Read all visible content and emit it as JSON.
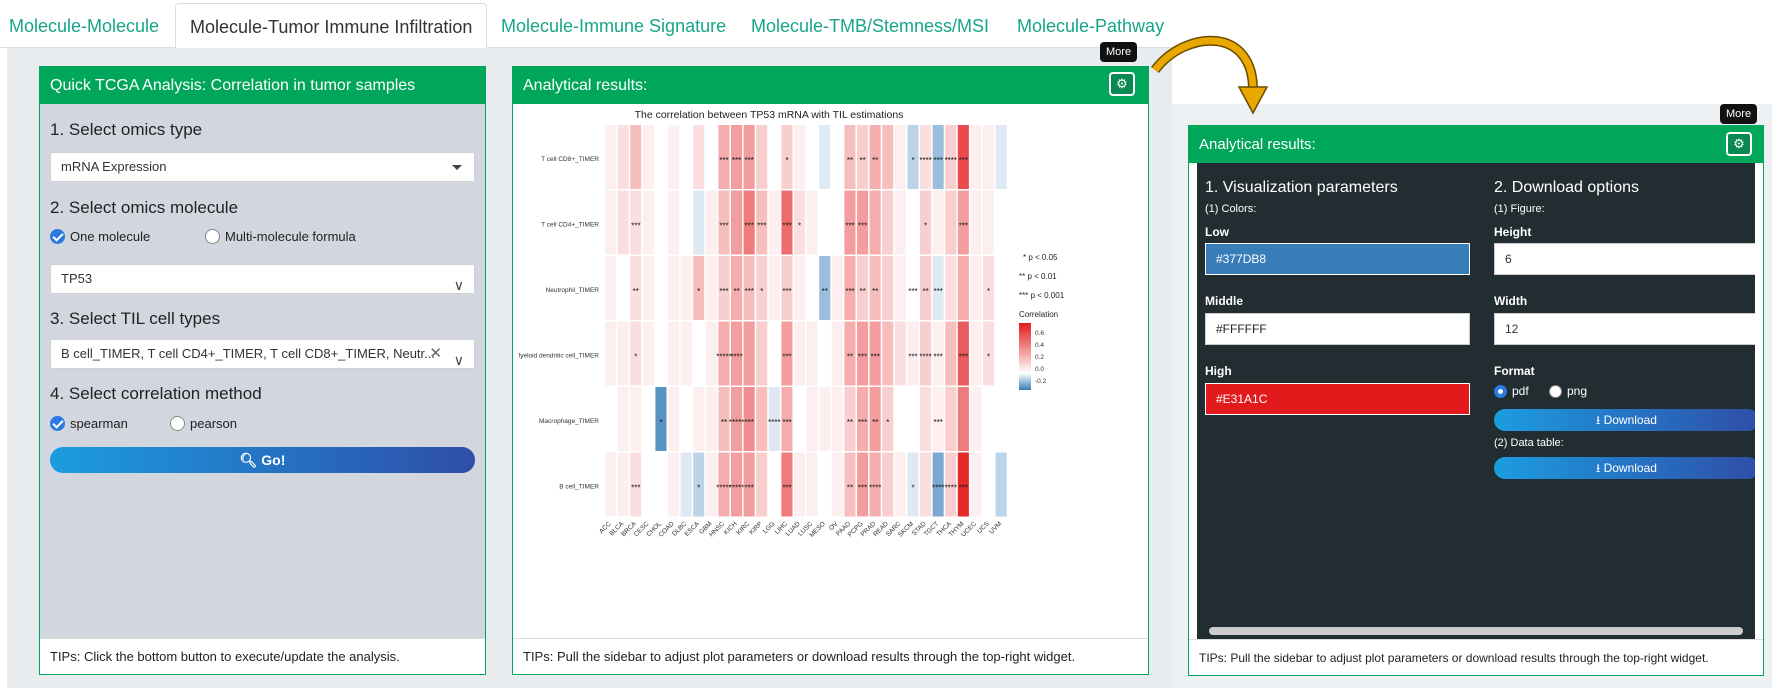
{
  "tabs": [
    "Molecule-Molecule",
    "Molecule-Tumor Immune Infiltration",
    "Molecule-Immune Signature",
    "Molecule-TMB/Stemness/MSI",
    "Molecule-Pathway"
  ],
  "sidebar": {
    "title": "Quick TCGA Analysis: Correlation in tumor samples",
    "step1_label": "1. Select omics type",
    "omics_type": "mRNA Expression",
    "step2_label": "2. Select omics molecule",
    "radio_one": "One molecule",
    "radio_multi": "Multi-molecule formula",
    "molecule": "TP53",
    "step3_label": "3. Select TIL cell types",
    "til_types": "B cell_TIMER, T cell CD4+_TIMER, T cell CD8+_TIMER, Neutr...",
    "step4_label": "4. Select correlation method",
    "method_spearman": "spearman",
    "method_pearson": "pearson",
    "go_label": "Go!",
    "tips": "TIPs: Click the bottom button to execute/update the analysis."
  },
  "results": {
    "title": "Analytical results:",
    "tooltip": "More",
    "tips": "TIPs: Pull the sidebar to adjust plot parameters or download results through the top-right widget."
  },
  "chart_data": {
    "type": "heatmap",
    "title": "The correlation between TP53 mRNA with TIL estimations",
    "rows": [
      "T cell CD8+_TIMER",
      "T cell CD4+_TIMER",
      "Neutrophil_TIMER",
      "Myeloid dendritic cell_TIMER",
      "Macrophage_TIMER",
      "B cell_TIMER"
    ],
    "columns": [
      "ACC",
      "BLCA",
      "BRCA",
      "CESC",
      "CHOL",
      "COAD",
      "DLBC",
      "ESCA",
      "GBM",
      "HNSC",
      "KICH",
      "KIRC",
      "KIRP",
      "LGG",
      "LIHC",
      "LUAD",
      "LUSC",
      "MESO",
      "OV",
      "PAAD",
      "PCPG",
      "PRAD",
      "READ",
      "SARC",
      "SKCM",
      "STAD",
      "TGCT",
      "THCA",
      "THYM",
      "UCEC",
      "UCS",
      "UVM"
    ],
    "values": [
      [
        0.05,
        0.1,
        0.2,
        0.05,
        0.0,
        0.05,
        0.0,
        0.1,
        0.0,
        0.25,
        0.3,
        0.3,
        0.15,
        0.0,
        0.15,
        0.05,
        0.0,
        -0.05,
        0.0,
        0.2,
        0.15,
        0.25,
        0.2,
        0.05,
        -0.1,
        0.1,
        -0.15,
        0.15,
        0.55,
        0.05,
        0.05,
        -0.05
      ],
      [
        0.05,
        0.1,
        0.1,
        0.05,
        0.0,
        0.05,
        0.0,
        -0.05,
        0.05,
        0.2,
        0.3,
        0.4,
        0.2,
        0.05,
        0.45,
        0.1,
        0.05,
        0.0,
        0.0,
        0.3,
        0.3,
        0.25,
        0.15,
        0.05,
        0.0,
        0.15,
        0.05,
        0.15,
        0.3,
        0.05,
        0.05,
        0.0
      ],
      [
        0.05,
        0.0,
        0.1,
        0.05,
        0.0,
        0.05,
        0.05,
        0.2,
        0.05,
        0.15,
        0.25,
        0.2,
        0.15,
        0.05,
        0.15,
        0.05,
        0.0,
        -0.15,
        0.05,
        0.25,
        0.15,
        0.2,
        0.15,
        0.05,
        0.0,
        0.15,
        -0.05,
        0.1,
        0.25,
        0.05,
        0.1,
        0.0
      ],
      [
        0.05,
        0.05,
        0.1,
        0.05,
        0.0,
        0.05,
        0.05,
        0.0,
        0.05,
        0.25,
        0.3,
        0.3,
        0.15,
        0.0,
        0.3,
        0.05,
        0.05,
        0.0,
        0.05,
        0.25,
        0.3,
        0.3,
        0.2,
        0.1,
        0.05,
        0.15,
        0.05,
        0.2,
        0.5,
        0.05,
        0.1,
        0.0
      ],
      [
        0.0,
        0.05,
        0.05,
        0.0,
        -0.25,
        0.05,
        0.0,
        0.05,
        0.05,
        0.2,
        0.3,
        0.35,
        0.2,
        -0.05,
        0.25,
        0.0,
        0.05,
        0.05,
        0.05,
        0.15,
        0.25,
        0.3,
        0.15,
        0.0,
        0.0,
        0.1,
        0.05,
        0.15,
        0.4,
        0.05,
        0.0,
        0.0
      ],
      [
        0.05,
        0.05,
        0.1,
        0.0,
        0.0,
        0.05,
        -0.05,
        -0.1,
        0.05,
        0.25,
        0.3,
        0.3,
        0.15,
        0.0,
        0.4,
        0.05,
        0.05,
        0.0,
        0.05,
        0.2,
        0.3,
        0.25,
        0.15,
        0.05,
        -0.05,
        0.1,
        -0.2,
        0.15,
        0.65,
        0.05,
        0.0,
        -0.1
      ]
    ],
    "stars": [
      [
        "",
        "",
        "",
        "",
        "",
        "",
        "",
        "",
        "",
        "***",
        "***",
        "***",
        "",
        "",
        "*",
        "",
        "",
        "",
        "",
        "**",
        "**",
        "**",
        "",
        "",
        "*",
        "****",
        "***",
        "****",
        "***",
        "",
        "",
        ""
      ],
      [
        "",
        "",
        "***",
        "",
        "",
        "",
        "",
        "",
        "",
        "***",
        "",
        "***",
        "***",
        "",
        "***",
        "*",
        "",
        "",
        "",
        "***",
        "***",
        "",
        "",
        "",
        "",
        "*",
        "",
        "",
        "***",
        "",
        "",
        ""
      ],
      [
        "",
        "",
        "**",
        "",
        "",
        "",
        "",
        "*",
        "",
        "***",
        "**",
        "***",
        "*",
        "",
        "***",
        "",
        "",
        "**",
        "",
        "***",
        "**",
        "**",
        "",
        "",
        "***",
        "**",
        "***",
        "",
        "",
        "",
        "*",
        ""
      ],
      [
        "",
        "",
        "*",
        "",
        "",
        "",
        "",
        "",
        "",
        "*****",
        "****",
        "",
        "",
        "",
        "***",
        "",
        "",
        "",
        "",
        "**",
        "***",
        "***",
        "",
        "",
        "***",
        "****",
        "***",
        "",
        "***",
        "",
        "*",
        ""
      ],
      [
        "",
        "",
        "",
        "",
        "*",
        "",
        "",
        "",
        "",
        "**",
        "*****",
        "***",
        "",
        "****",
        "***",
        "",
        "",
        "",
        "",
        "**",
        "***",
        "**",
        "*",
        "",
        "",
        "",
        "***",
        "",
        "",
        "",
        "",
        ""
      ],
      [
        "",
        "",
        "***",
        "",
        "",
        "",
        "",
        "*",
        "",
        "*****",
        "*****",
        "***",
        "",
        "",
        "***",
        "",
        "",
        "",
        "",
        "**",
        "***",
        "****",
        "",
        "",
        "*",
        "",
        "****",
        "****",
        "***",
        "",
        "",
        ""
      ]
    ],
    "legend_sig": [
      "* p < 0.05",
      "** p < 0.01",
      "*** p < 0.001"
    ],
    "legend_title": "Correlation",
    "legend_ticks": [
      "0.6",
      "0.4",
      "0.2",
      "0.0",
      "-0.2"
    ],
    "colors": {
      "low": "#377DB8",
      "mid": "#FFFFFF",
      "high": "#E31A1C"
    }
  },
  "settings": {
    "title": "Analytical results:",
    "tooltip": "More",
    "vis_title": "1. Visualization parameters",
    "colors_sub": "(1) Colors:",
    "low_label": "Low",
    "low_value": "#377DB8",
    "middle_label": "Middle",
    "middle_value": "#FFFFFF",
    "high_label": "High",
    "high_value": "#E31A1C",
    "dl_title": "2. Download options",
    "figure_sub": "(1) Figure:",
    "height_label": "Height",
    "height_value": "6",
    "width_label": "Width",
    "width_value": "12",
    "format_label": "Format",
    "fmt_pdf": "pdf",
    "fmt_png": "png",
    "download_label": "Download",
    "table_sub": "(2) Data table:",
    "tips": "TIPs: Pull the sidebar to adjust plot parameters or download results through the top-right widget."
  }
}
